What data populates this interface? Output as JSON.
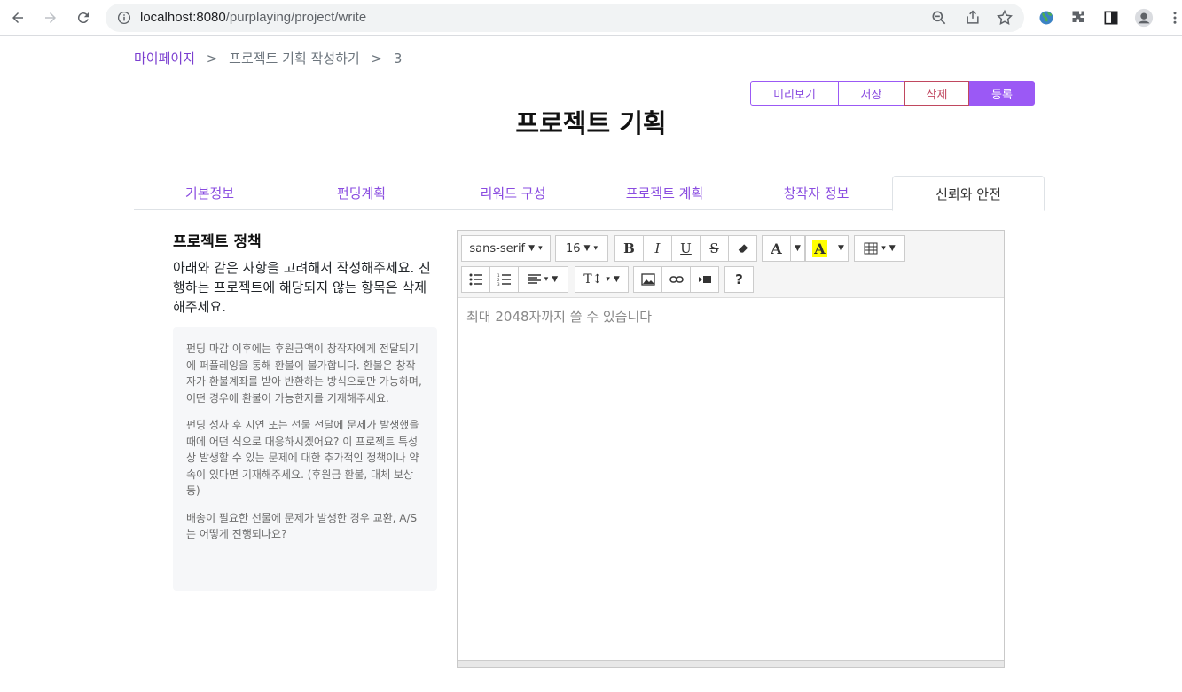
{
  "browser": {
    "url_host": "localhost:8080",
    "url_path": "/purplaying/project/write"
  },
  "breadcrumb": {
    "home": "마이페이지",
    "separator": ">",
    "current": "프로젝트 기획 작성하기",
    "step": "3"
  },
  "actions": {
    "preview": "미리보기",
    "save": "저장",
    "delete": "삭제",
    "submit": "등록"
  },
  "page_title": "프로젝트 기획",
  "tabs": [
    {
      "label": "기본정보"
    },
    {
      "label": "펀딩계획"
    },
    {
      "label": "리워드 구성"
    },
    {
      "label": "프로젝트 계획"
    },
    {
      "label": "창작자 정보"
    },
    {
      "label": "신뢰와 안전"
    }
  ],
  "policy": {
    "title": "프로젝트 정책",
    "description": "아래와 같은 사항을 고려해서 작성해주세요. 진행하는 프로젝트에 해당되지 않는 항목은 삭제해주세요.",
    "guides": [
      "펀딩 마감 이후에는 후원금액이 창작자에게 전달되기에 퍼플레잉을 통해 환불이 불가합니다. 환불은 창작자가 환불계좌를 받아 반환하는 방식으로만 가능하며, 어떤 경우에 환불이 가능한지를 기재해주세요.",
      "펀딩 성사 후 지연 또는 선물 전달에 문제가 발생했을 때에 어떤 식으로 대응하시겠어요? 이 프로젝트 특성상 발생할 수 있는 문제에 대한 추가적인 정책이나 약속이 있다면 기재해주세요. (후원금 환불, 대체 보상 등)",
      "배송이 필요한 선물에 문제가 발생한 경우 교환, A/S는 어떻게 진행되나요?"
    ]
  },
  "editor": {
    "font_family": "sans-serif",
    "font_size": "16",
    "placeholder": "최대 2048자까지 쓸 수 있습니다",
    "help_label": "?"
  },
  "colors": {
    "accent": "#9b59f5",
    "danger": "#c0475f"
  }
}
